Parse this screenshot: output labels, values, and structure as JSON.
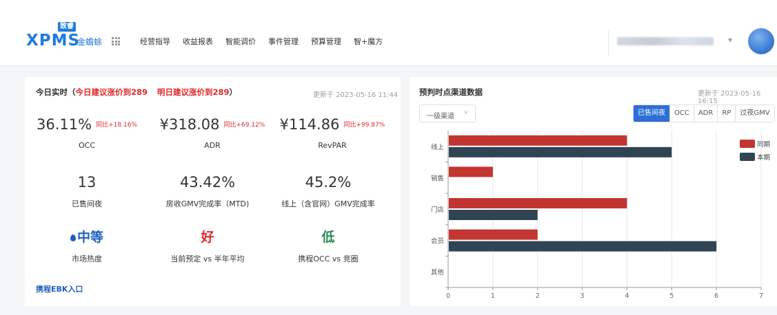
{
  "header": {
    "logo_badge": "致睿",
    "logo_text": "XPMS",
    "hotel_name": "金蟾蜍",
    "nav": [
      {
        "label": "经营指导",
        "active": true
      },
      {
        "label": "收益报表",
        "active": false
      },
      {
        "label": "智能调价",
        "active": false
      },
      {
        "label": "事件管理",
        "active": false
      },
      {
        "label": "预算管理",
        "active": false
      },
      {
        "label": "智+魔方",
        "active": false
      }
    ],
    "icons": [
      "grid-icon",
      "chevron-down-icon",
      "avatar"
    ]
  },
  "today": {
    "title": "今日实时（",
    "suggest_today": "今日建议涨价到289",
    "suggest_tomorrow": "明日建议涨价到289",
    "title_end": "）",
    "updated": "更新于 2023-05-16 11:44",
    "metrics": [
      {
        "value": "36.11%",
        "compare": "同比+18.16%",
        "label": "OCC"
      },
      {
        "value": "¥318.08",
        "compare": "同比+69.12%",
        "label": "ADR"
      },
      {
        "value": "¥114.86",
        "compare": "同比+99.87%",
        "label": "RevPAR"
      },
      {
        "value": "13",
        "compare": "",
        "label": "已售间夜"
      },
      {
        "value": "43.42%",
        "compare": "",
        "label": "房收GMV完成率（MTD)"
      },
      {
        "value": "45.2%",
        "compare": "",
        "label": "线上（含官网）GMV完成率"
      },
      {
        "value": "中等",
        "compare": "",
        "label": "市场热度"
      },
      {
        "value": "好",
        "compare": "",
        "label": "当前预定 vs 半年平均"
      },
      {
        "value": "低",
        "compare": "",
        "label": "携程OCC vs 竞圈"
      }
    ],
    "ebk_link": "携程EBK入口"
  },
  "channel": {
    "title": "预判时点渠道数据",
    "updated": "更新于 2023-05-16 16:15",
    "select_value": "一级渠道",
    "tabs": [
      {
        "label": "已售间夜",
        "active": true
      },
      {
        "label": "OCC",
        "active": false
      },
      {
        "label": "ADR",
        "active": false
      },
      {
        "label": "RP",
        "active": false
      },
      {
        "label": "过夜GMV",
        "active": false
      }
    ]
  },
  "chart_data": {
    "type": "bar",
    "orientation": "horizontal",
    "categories": [
      "线上",
      "销售",
      "门店",
      "会员",
      "其他"
    ],
    "series": [
      {
        "name": "同期",
        "values": [
          4,
          1,
          4,
          2,
          0
        ],
        "color": "#c23531"
      },
      {
        "name": "本期",
        "values": [
          5,
          0,
          2,
          6,
          0
        ],
        "color": "#2f4554"
      }
    ],
    "xlim": [
      0,
      7
    ],
    "xticks": [
      "0",
      "1",
      "2",
      "3",
      "4",
      "5",
      "6",
      "7"
    ],
    "grid": true,
    "legend_position": "top-right"
  }
}
